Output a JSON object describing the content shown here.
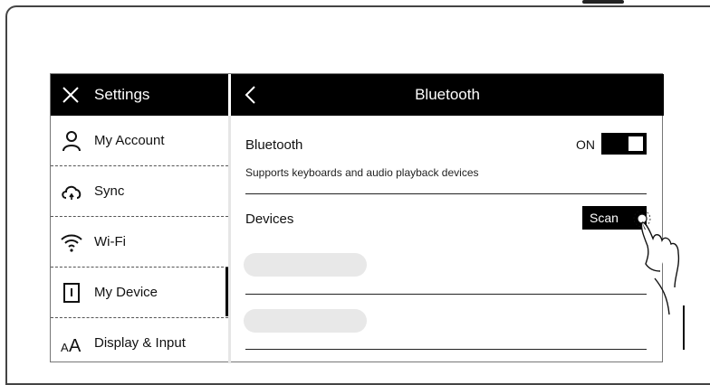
{
  "header": {
    "settings_title": "Settings",
    "page_title": "Bluetooth"
  },
  "sidebar": {
    "items": [
      {
        "label": "My Account",
        "icon": "person-icon"
      },
      {
        "label": "Sync",
        "icon": "cloud-sync-icon"
      },
      {
        "label": "Wi-Fi",
        "icon": "wifi-icon"
      },
      {
        "label": "My Device",
        "icon": "device-icon",
        "active": true
      },
      {
        "label": "Display & Input",
        "icon": "text-size-icon"
      }
    ]
  },
  "bluetooth": {
    "label": "Bluetooth",
    "state_label": "ON",
    "enabled": true,
    "description": "Supports keyboards and audio playback devices"
  },
  "devices": {
    "label": "Devices",
    "scan_label": "Scan"
  }
}
